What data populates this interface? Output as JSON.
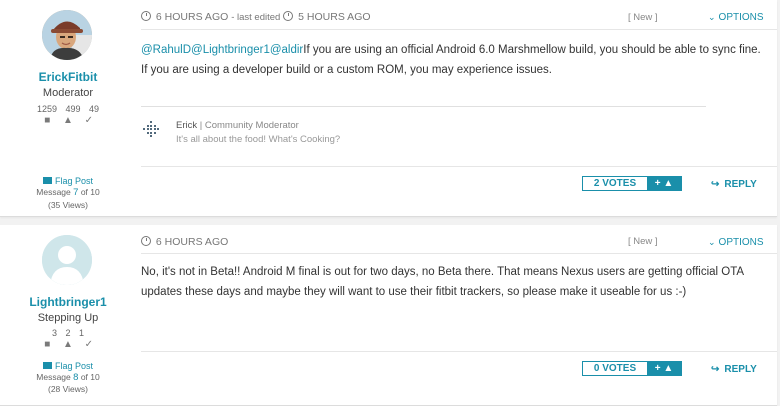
{
  "posts": [
    {
      "author": {
        "username": "ErickFitbit",
        "rank": "Moderator",
        "stats": [
          "1259",
          "499",
          "49"
        ]
      },
      "time": "6 HOURS AGO",
      "edited_prefix": "- last edited",
      "edited_time": "5 HOURS AGO",
      "status": "[ New ]",
      "options_label": "OPTIONS",
      "body": {
        "mentions": [
          "@RahulD",
          "@Lightbringer1",
          "@aldir"
        ],
        "text": "If you are using an official Android 6.0 Marshmellow build, you should be able to sync fine. If you are using a developer build or a custom ROM, you may experience issues."
      },
      "signature": {
        "name": "Erick",
        "role": "| Community Moderator",
        "text": "It's all about the food! What's Cooking?"
      },
      "flag_label": "Flag Post",
      "message_prefix": "Message",
      "message_number": "7",
      "message_suffix": "of 10",
      "views": "(35 Views)",
      "votes_label": "2 VOTES",
      "vote_button": "+",
      "reply_label": "REPLY"
    },
    {
      "author": {
        "username": "Lightbringer1",
        "rank": "Stepping Up",
        "stats": [
          "3",
          "2",
          "1"
        ]
      },
      "time": "6 HOURS AGO",
      "status": "[ New ]",
      "options_label": "OPTIONS",
      "body": {
        "text": "No, it's not in Beta!! Android M final is out for two days, no Beta there. That means Nexus users are getting official OTA updates these days and maybe they will want to use their fitbit trackers, so please make it useable for us :-)"
      },
      "flag_label": "Flag Post",
      "message_prefix": "Message",
      "message_number": "8",
      "message_suffix": "of 10",
      "views": "(28 Views)",
      "votes_label": "0 VOTES",
      "vote_button": "+",
      "reply_label": "REPLY"
    }
  ],
  "colors": {
    "accent": "#1a8faa",
    "text": "#333333",
    "muted": "#777777"
  },
  "icons": [
    "clock-icon",
    "chevron-down-icon",
    "comment-icon",
    "thumbs-up-icon",
    "check-icon",
    "flag-icon",
    "reply-arrow-icon",
    "fitbit-logo"
  ]
}
